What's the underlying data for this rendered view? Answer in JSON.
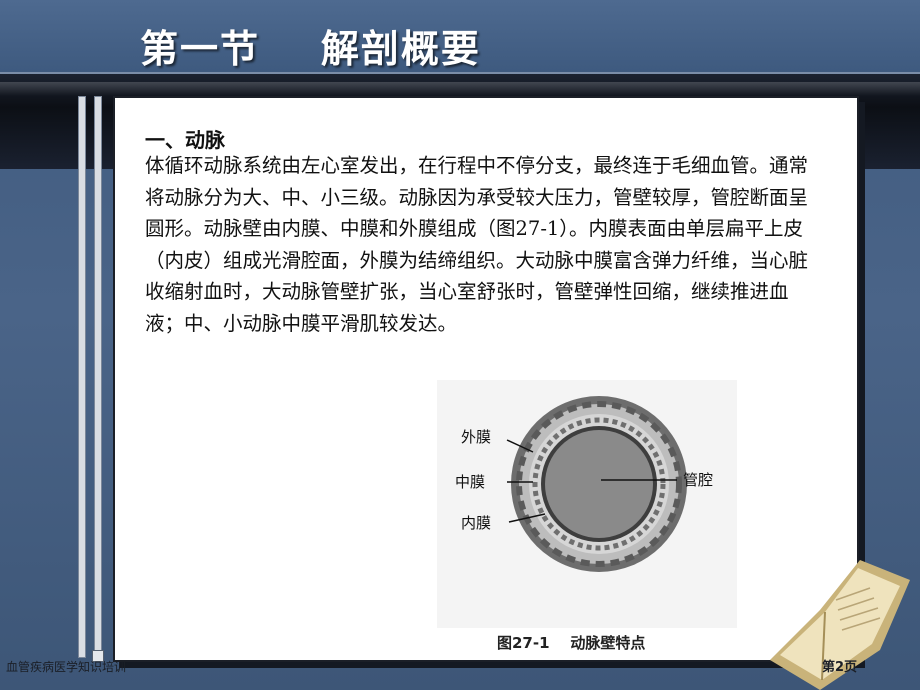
{
  "slide": {
    "title": "第一节    解剖概要",
    "heading": "一、动脉",
    "body": "体循环动脉系统由左心室发出，在行程中不停分支，最终连于毛细血管。通常将动脉分为大、中、小三级。动脉因为承受较大压力，管壁较厚，管腔断面呈圆形。动脉壁由内膜、中膜和外膜组成（图27-1）。内膜表面由单层扁平上皮（内皮）组成光滑腔面，外膜为结缔组织。大动脉中膜富含弹力纤维，当心脏收缩射血时，大动脉管壁扩张，当心室舒张时，管壁弹性回缩，继续推进血液；中、小动脉中膜平滑肌较发达。"
  },
  "figure": {
    "labels": {
      "outer": "外膜",
      "middle": "中膜",
      "inner": "内膜",
      "lumen": "管腔"
    },
    "caption": "图27-1    动脉壁特点"
  },
  "footer": {
    "left": "血管疾病医学知识培训",
    "page": "第2页"
  },
  "colors": {
    "background": "#4a6488",
    "band": "#0c0f15",
    "card": "#ffffff"
  }
}
